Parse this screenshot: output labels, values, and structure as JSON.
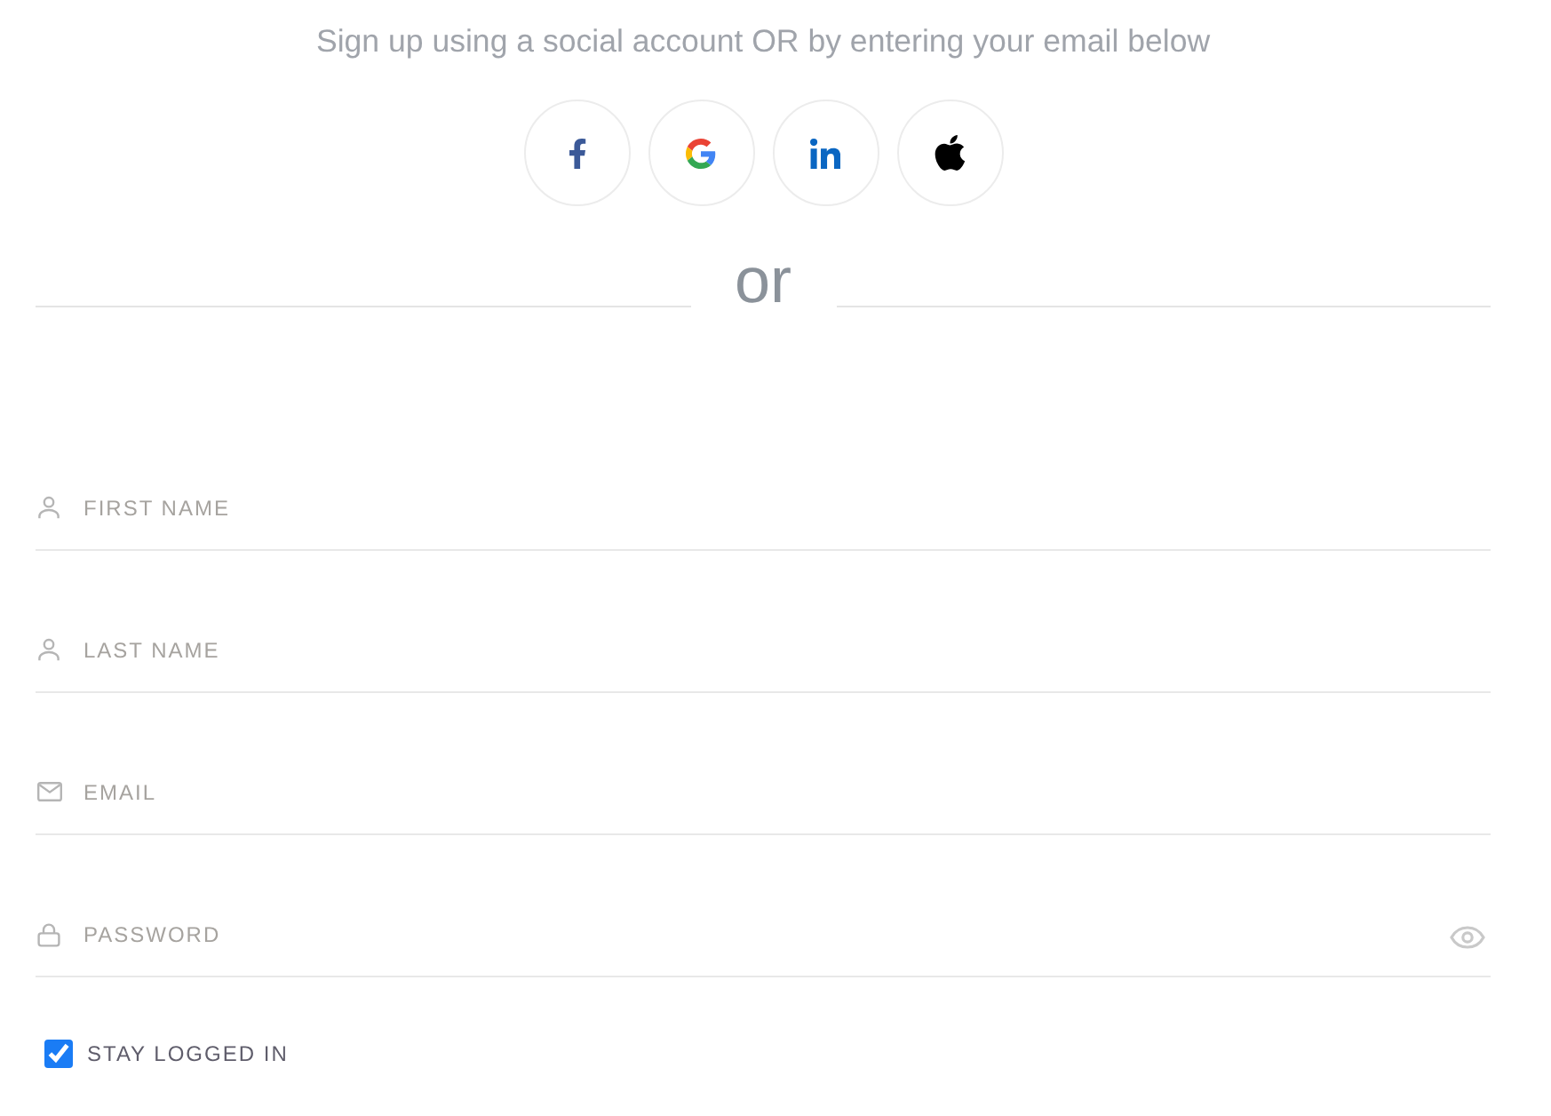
{
  "subtitle": "Sign up using a social account OR by entering your email below",
  "social_buttons": [
    {
      "kind": "facebook"
    },
    {
      "kind": "google"
    },
    {
      "kind": "linkedin"
    },
    {
      "kind": "apple"
    }
  ],
  "divider": {
    "label": "or"
  },
  "fields": [
    {
      "kind": "person",
      "placeholder": "FIRST NAME"
    },
    {
      "kind": "person",
      "placeholder": "LAST NAME"
    },
    {
      "kind": "mail",
      "placeholder": "EMAIL"
    },
    {
      "kind": "lock",
      "placeholder": "PASSWORD",
      "reveal_toggle": true
    }
  ],
  "stay_logged_in": {
    "label": "STAY LOGGED IN",
    "checked": true
  }
}
